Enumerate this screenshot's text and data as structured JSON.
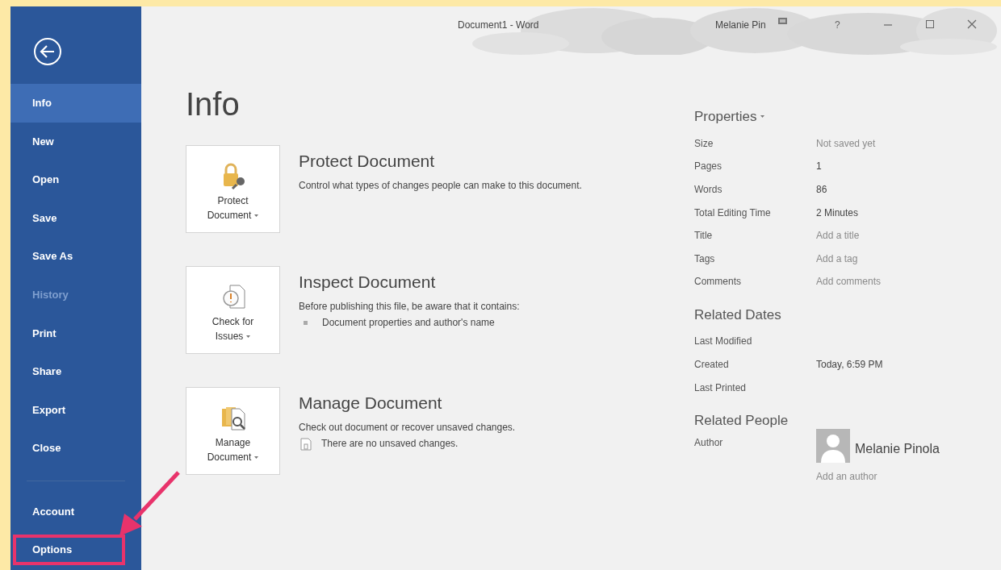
{
  "window": {
    "title": "Document1 - Word",
    "user": "Melanie Pin",
    "help": "?"
  },
  "sidebar": {
    "items": [
      {
        "label": "Info",
        "selected": true,
        "disabled": false,
        "highlighted": false
      },
      {
        "label": "New",
        "selected": false,
        "disabled": false,
        "highlighted": false
      },
      {
        "label": "Open",
        "selected": false,
        "disabled": false,
        "highlighted": false
      },
      {
        "label": "Save",
        "selected": false,
        "disabled": false,
        "highlighted": false
      },
      {
        "label": "Save As",
        "selected": false,
        "disabled": false,
        "highlighted": false
      },
      {
        "label": "History",
        "selected": false,
        "disabled": true,
        "highlighted": false
      },
      {
        "label": "Print",
        "selected": false,
        "disabled": false,
        "highlighted": false
      },
      {
        "label": "Share",
        "selected": false,
        "disabled": false,
        "highlighted": false
      },
      {
        "label": "Export",
        "selected": false,
        "disabled": false,
        "highlighted": false
      },
      {
        "label": "Close",
        "selected": false,
        "disabled": false,
        "highlighted": false
      }
    ],
    "bottom_items": [
      {
        "label": "Account",
        "selected": false,
        "disabled": false,
        "highlighted": false
      },
      {
        "label": "Options",
        "selected": false,
        "disabled": false,
        "highlighted": true
      }
    ]
  },
  "page_title": "Info",
  "sections": [
    {
      "kind": "protect",
      "button_label": [
        "Protect",
        "Document"
      ],
      "title": "Protect Document",
      "description": "Control what types of changes people can make to this document."
    },
    {
      "kind": "inspect",
      "button_label": [
        "Check for",
        "Issues"
      ],
      "title": "Inspect Document",
      "description": "Before publishing this file, be aware that it contains:",
      "detail": {
        "kind": "bullet",
        "text": "Document properties and author's name"
      }
    },
    {
      "kind": "manage",
      "button_label": [
        "Manage",
        "Document"
      ],
      "title": "Manage Document",
      "description": "Check out document or recover unsaved changes.",
      "detail": {
        "kind": "note",
        "text": "There are no unsaved changes."
      }
    }
  ],
  "properties": {
    "heading": "Properties",
    "rows": [
      {
        "label": "Size",
        "value": "Not saved yet",
        "muted": true
      },
      {
        "label": "Pages",
        "value": "1",
        "muted": false
      },
      {
        "label": "Words",
        "value": "86",
        "muted": false
      },
      {
        "label": "Total Editing Time",
        "value": "2 Minutes",
        "muted": false
      },
      {
        "label": "Title",
        "value": "Add a title",
        "muted": true
      },
      {
        "label": "Tags",
        "value": "Add a tag",
        "muted": true
      },
      {
        "label": "Comments",
        "value": "Add comments",
        "muted": true
      }
    ]
  },
  "related_dates": {
    "heading": "Related Dates",
    "rows": [
      {
        "label": "Last Modified"
      },
      {
        "label": "Created",
        "value": "Today, 6:59 PM",
        "muted": false
      },
      {
        "label": "Last Printed"
      }
    ]
  },
  "related_people": {
    "heading": "Related People",
    "label": "Author",
    "author": "Melanie Pinola",
    "add_link": "Add an author"
  }
}
